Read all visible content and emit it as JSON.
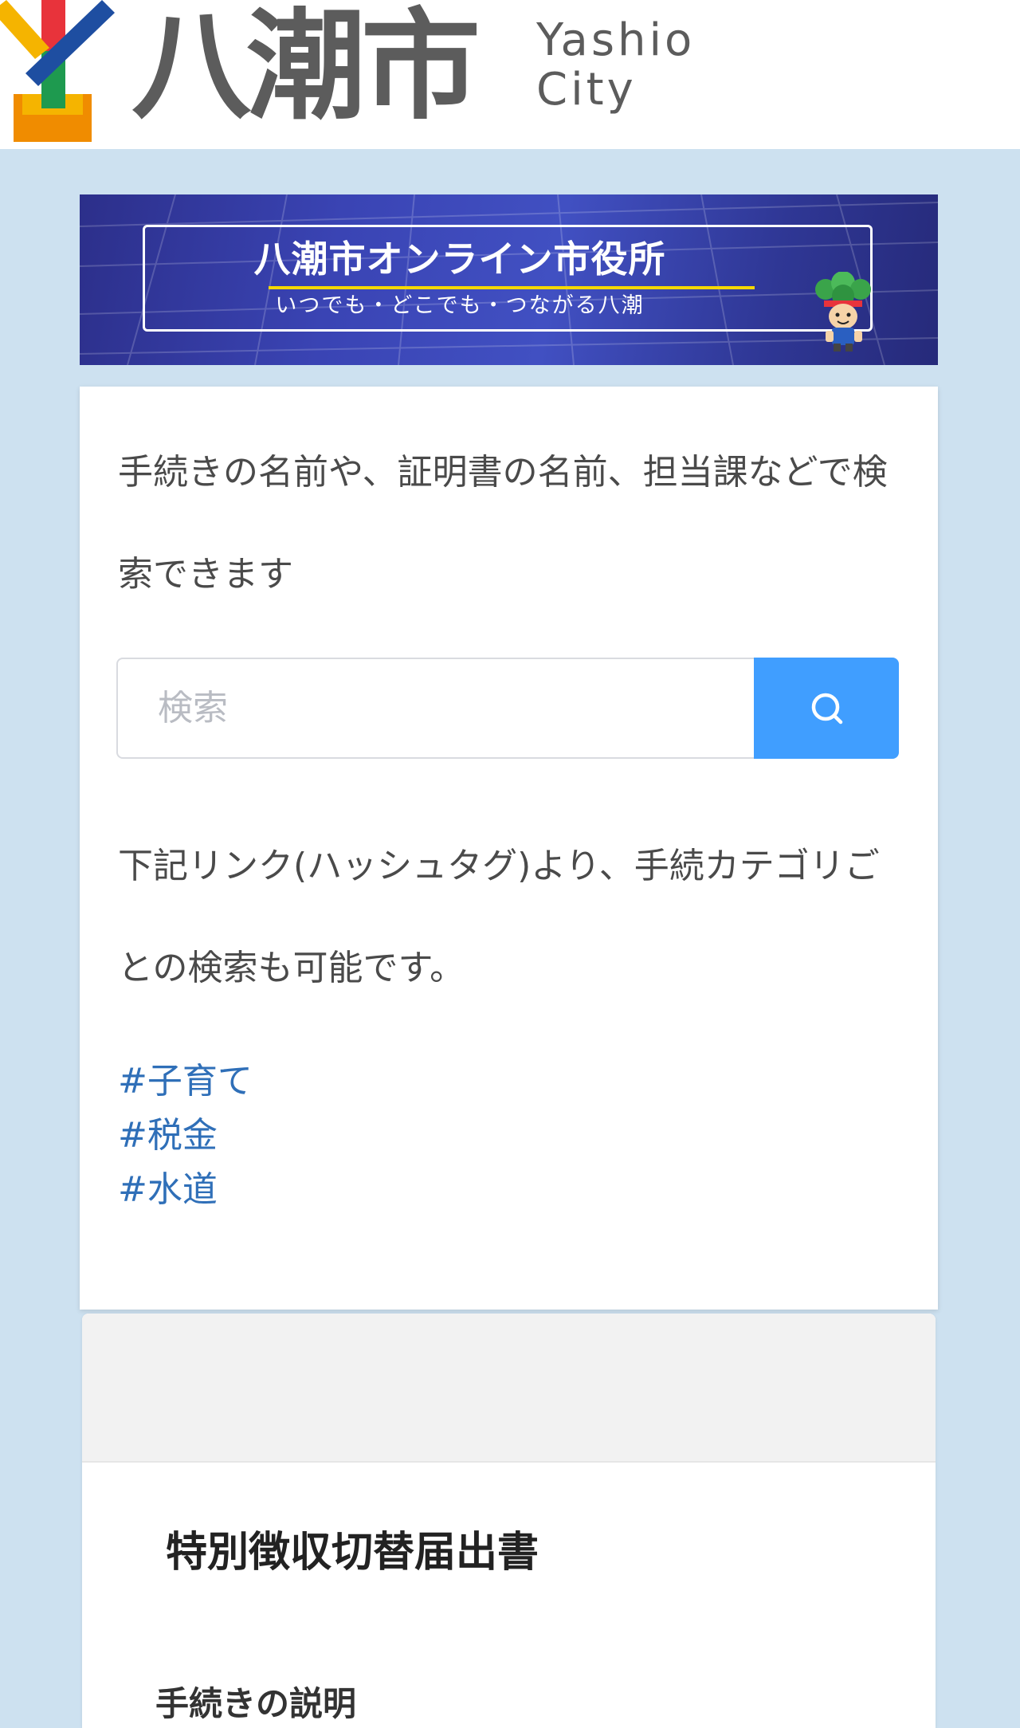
{
  "header": {
    "logo_jp": "八潮市",
    "logo_en_line1": "Yashio",
    "logo_en_line2": "City",
    "logo_colors": [
      "#e8333b",
      "#1e4ea1",
      "#1e9a4f",
      "#f5b400",
      "#f08c00"
    ]
  },
  "banner": {
    "title": "八潮市オンライン市役所",
    "subtitle": "いつでも・どこでも・つながる八潮",
    "accent_color": "#f5d800"
  },
  "search_card": {
    "description": "手続きの名前や、証明書の名前、担当課などで検索できます",
    "search_placeholder": "検索",
    "search_button_icon": "search-icon",
    "search_button_color": "#409eff",
    "category_hint": "下記リンク(ハッシュタグ)より、手続カテゴリごとの検索も可能です。",
    "tags": [
      "#子育て",
      "#税金",
      "#水道"
    ]
  },
  "result_card": {
    "title": "特別徴収切替届出書",
    "section_heading": "手続きの説明"
  }
}
